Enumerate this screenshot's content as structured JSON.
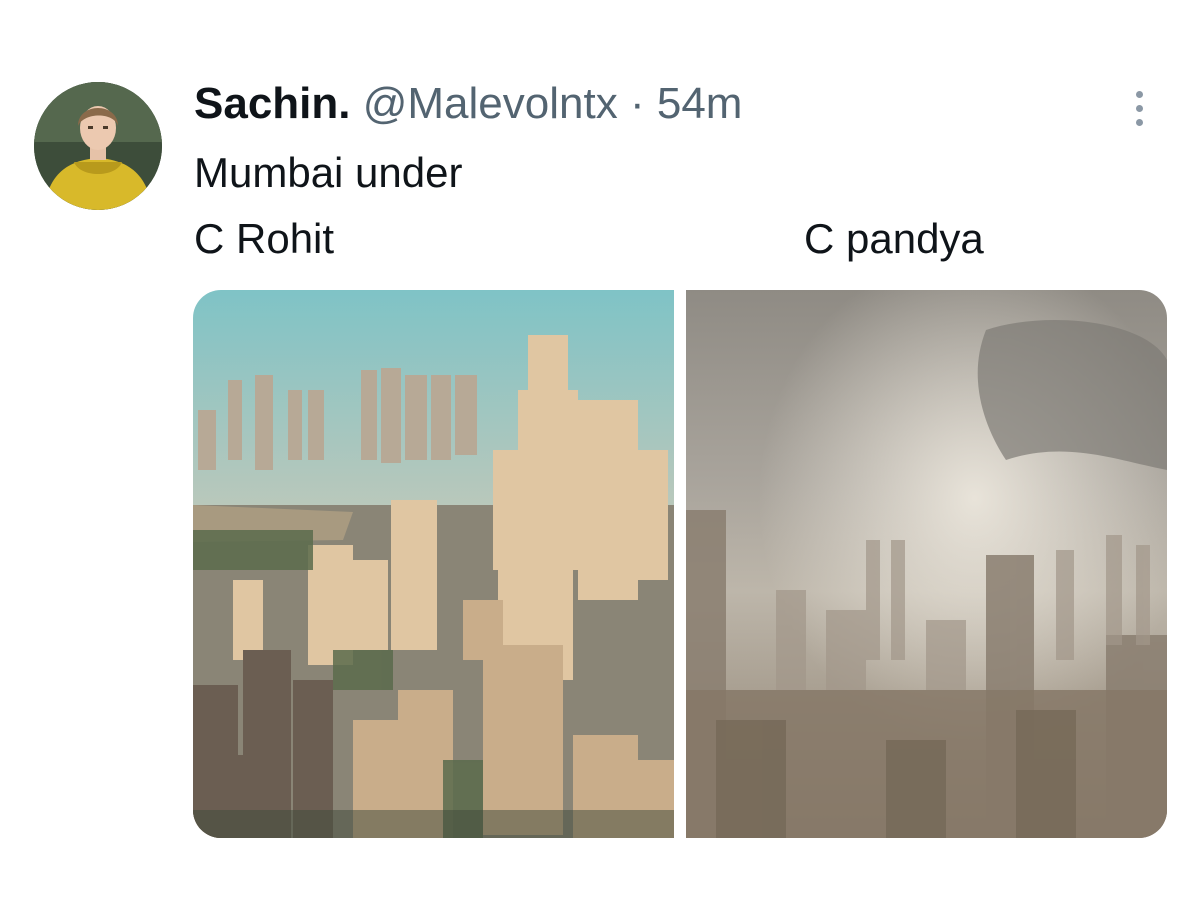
{
  "tweet": {
    "author_name": "Sachin.",
    "handle": "@Malevolntx",
    "separator": "·",
    "time": "54m",
    "line1": "Mumbai under",
    "label_left": "C Rohit",
    "label_right": "C pandya"
  },
  "icons": {
    "more": "more-options-icon",
    "avatar": "user-avatar"
  },
  "colors": {
    "text_primary": "#0f1419",
    "text_secondary": "#536471"
  }
}
